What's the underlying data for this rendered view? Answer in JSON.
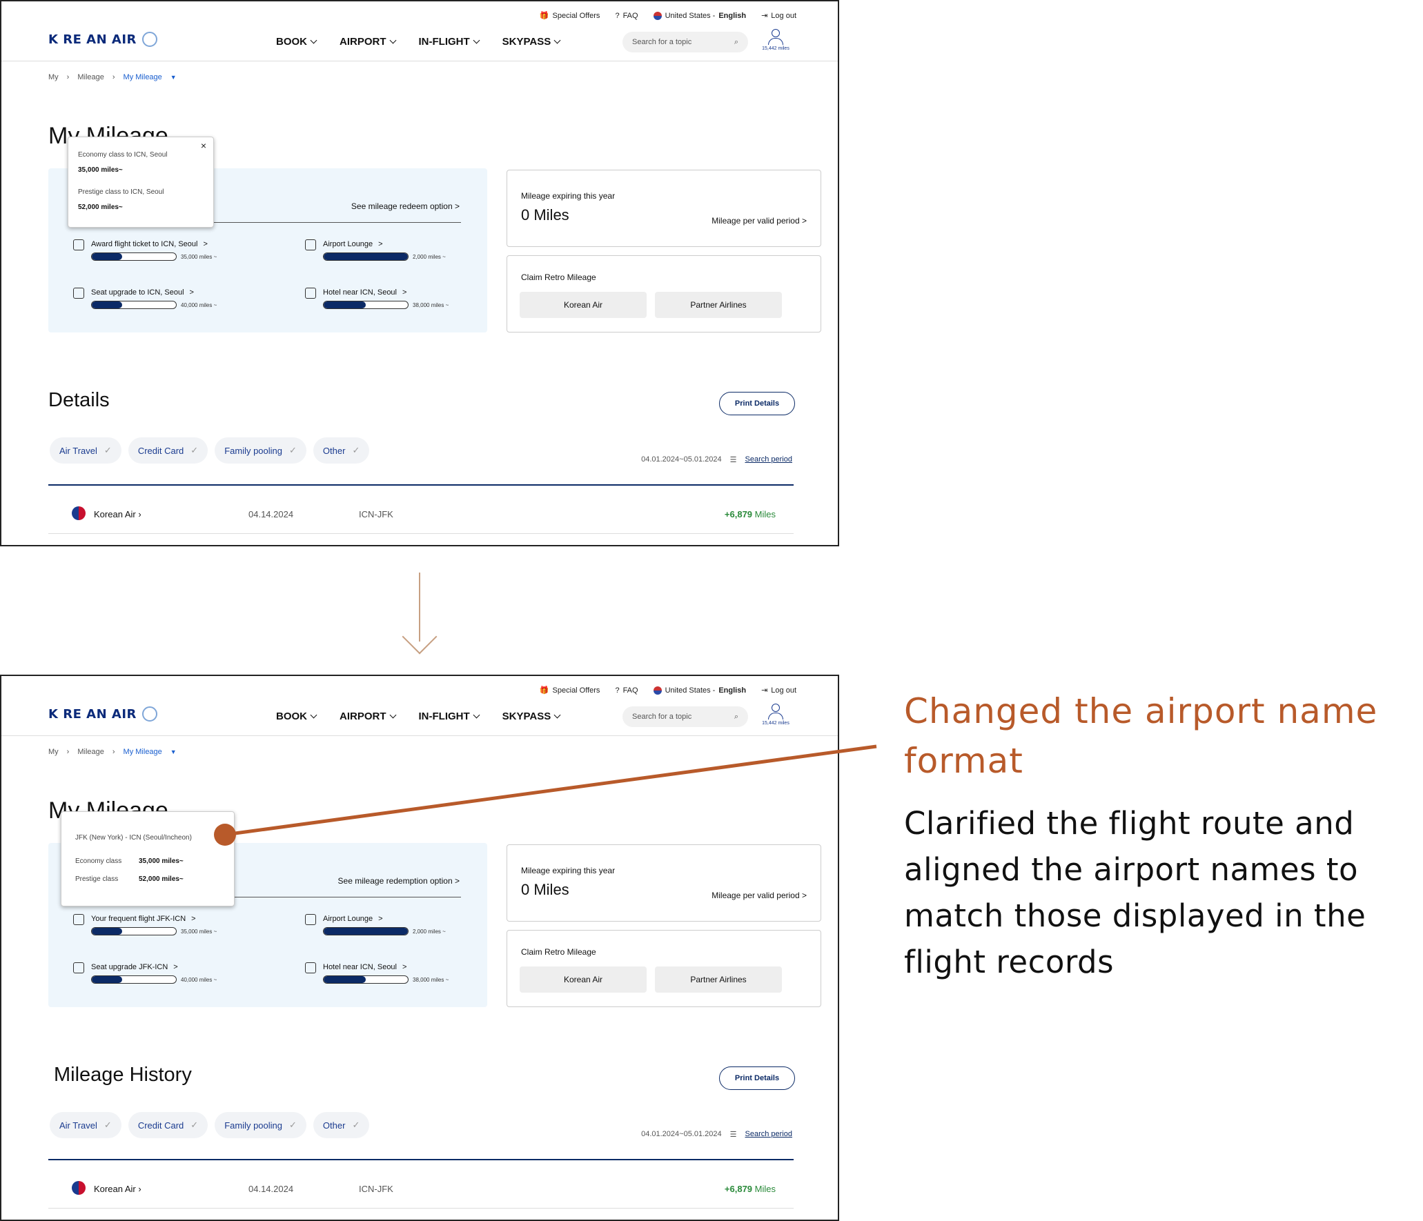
{
  "colors": {
    "accent": "#b85a2a",
    "brand_navy": "#0b2a66",
    "arrow": "#c7a082",
    "positive": "#2a8a3a",
    "link_blue": "#1a5fcf"
  },
  "header": {
    "logo_text": "K RE AN AIR",
    "utility": {
      "special_offers": "Special Offers",
      "faq": "FAQ",
      "country": "United States -",
      "language": "English",
      "logout": "Log out"
    },
    "nav": [
      "BOOK",
      "AIRPORT",
      "IN-FLIGHT",
      "SKYPASS"
    ],
    "search_placeholder": "Search for a topic",
    "user_miles": "15,442 miles"
  },
  "breadcrumb": {
    "items": [
      "My",
      "Mileage"
    ],
    "current": "My Mileage"
  },
  "before": {
    "page_title": "My Mileage",
    "tooltip": {
      "line1_label": "Economy class to ICN, Seoul",
      "line1_value": "35,000 miles~",
      "line2_label": "Prestige class to ICN, Seoul",
      "line2_value": "52,000 miles~"
    },
    "redeem_link": "See mileage redeem option  >",
    "items": [
      {
        "label": "Award flight ticket to ICN, Seoul",
        "miles": "35,000 miles ~",
        "progress": 0.36,
        "icon": "plane-icon"
      },
      {
        "label": "Airport Lounge",
        "miles": "2,000 miles ~",
        "progress": 1.0,
        "icon": "lounge-seat-icon"
      },
      {
        "label": "Seat upgrade to ICN, Seoul",
        "miles": "40,000 miles ~",
        "progress": 0.36,
        "icon": "seat-icon"
      },
      {
        "label": "Hotel near ICN, Seoul",
        "miles": "38,000 miles ~",
        "progress": 0.5,
        "icon": "hotel-icon"
      }
    ],
    "section_title": "Details"
  },
  "after": {
    "page_title": "My Mileage",
    "tooltip": {
      "route": "JFK (New York) - ICN (Seoul/Incheon)",
      "line1_label": "Economy class",
      "line1_value": "35,000 miles~",
      "line2_label": "Prestige class",
      "line2_value": "52,000 miles~"
    },
    "redeem_link": "See mileage redemption option  >",
    "items": [
      {
        "label": "Your frequent flight  JFK-ICN",
        "miles": "35,000 miles ~",
        "progress": 0.36,
        "icon": "plane-icon"
      },
      {
        "label": "Airport Lounge",
        "miles": "2,000 miles ~",
        "progress": 1.0,
        "icon": "lounge-seat-icon"
      },
      {
        "label": "Seat upgrade  JFK-ICN",
        "miles": "40,000 miles ~",
        "progress": 0.36,
        "icon": "seat-icon"
      },
      {
        "label": "Hotel near ICN, Seoul",
        "miles": "38,000 miles ~",
        "progress": 0.5,
        "icon": "hotel-icon"
      }
    ],
    "section_title": "Mileage History"
  },
  "expiring": {
    "label": "Mileage expiring this year",
    "value": "0 Miles",
    "link": "Mileage per valid period  >"
  },
  "retro": {
    "label": "Claim Retro Mileage",
    "btn1": "Korean Air",
    "btn2": "Partner Airlines"
  },
  "print_btn": "Print Details",
  "filters": [
    "Air Travel",
    "Credit Card",
    "Family pooling",
    "Other"
  ],
  "period": {
    "range": "04.01.2024~05.01.2024",
    "link": "Search period"
  },
  "record": {
    "airline": "Korean Air",
    "date": "04.14.2024",
    "route": "ICN-JFK",
    "miles_value": "+6,879",
    "miles_unit": "Miles"
  },
  "annotation": {
    "title": "Changed the airport name format",
    "body": "Clarified the flight route and aligned the airport names to match those displayed in the flight records"
  }
}
